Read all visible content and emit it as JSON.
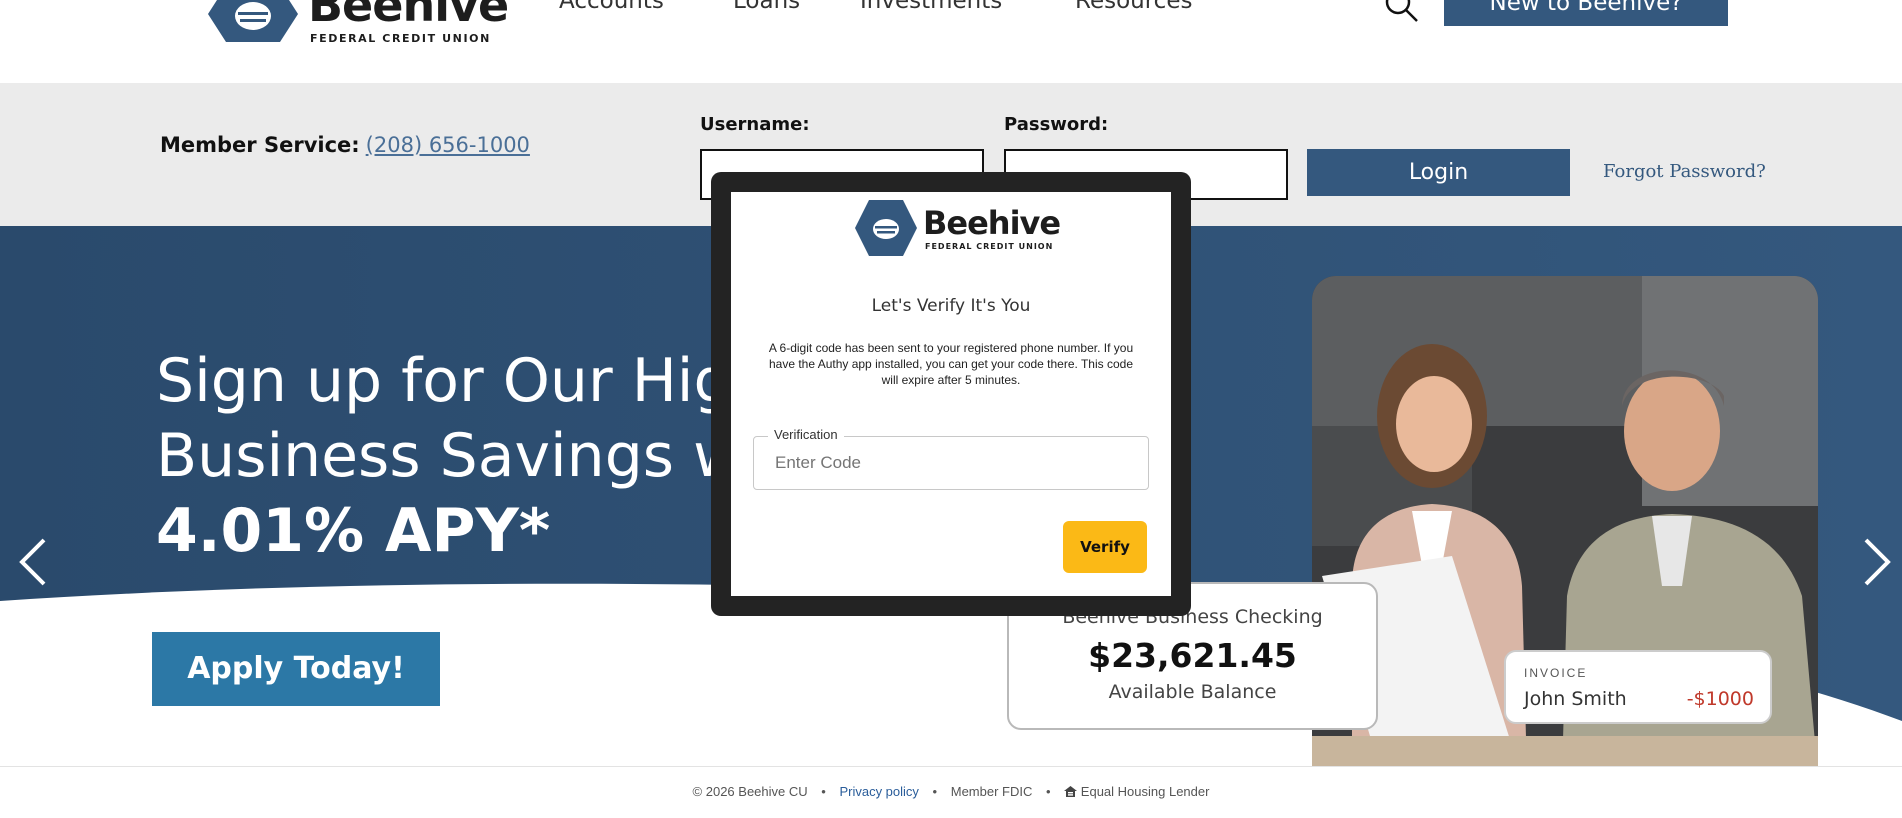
{
  "header": {
    "logo": {
      "name": "Beehive",
      "subtitle": "FEDERAL CREDIT UNION"
    },
    "nav": [
      {
        "label": "Accounts"
      },
      {
        "label": "Loans"
      },
      {
        "label": "Investments"
      },
      {
        "label": "Resources"
      }
    ],
    "new_button": "New to Beehive?",
    "icons": {
      "search": "search-icon"
    }
  },
  "login_bar": {
    "member_label": "Member Service:",
    "phone": "(208) 656-1000",
    "username_label": "Username:",
    "password_label": "Password:",
    "login_button": "Login",
    "forgot": "Forgot Password?"
  },
  "hero": {
    "headline_line1": "Sign up for Our Hig",
    "headline_line2": "Business Savings w",
    "headline_line3": "4.01% APY*",
    "apply_button": "Apply Today!",
    "card": {
      "title": "Beehive Business Checking",
      "amount": "$23,621.45",
      "caption": "Available Balance"
    },
    "invoice": {
      "label": "INVOICE",
      "name": "John Smith",
      "amount": "-$1000"
    },
    "colors": {
      "hero_bg": "#2a4a6c",
      "apply": "#2c78a6"
    }
  },
  "modal": {
    "logo": {
      "name": "Beehive",
      "subtitle": "FEDERAL CREDIT UNION"
    },
    "title": "Let's Verify It's You",
    "description": "A 6-digit code has been sent to your registered phone number. If you have the Authy app installed, you can get your code there. This code will expire after 5 minutes.",
    "field_label": "Verification",
    "field_placeholder": "Enter Code",
    "verify_button": "Verify",
    "colors": {
      "verify": "#fbb916"
    }
  },
  "footer": {
    "copyright": "© 2026 Beehive CU",
    "privacy": "Privacy policy",
    "fdic": "Member FDIC",
    "housing": "Equal Housing Lender"
  }
}
